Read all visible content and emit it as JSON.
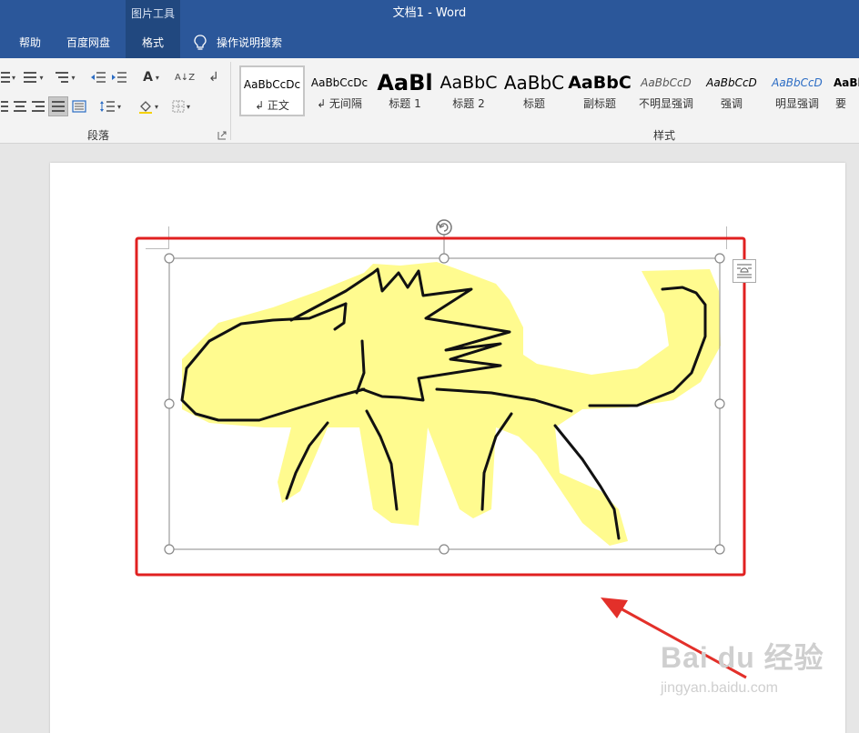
{
  "titlebar": {
    "context_group": "图片工具",
    "title": "文档1  -  Word"
  },
  "tabs": [
    {
      "label": "帮助",
      "active": false
    },
    {
      "label": "百度网盘",
      "active": false
    },
    {
      "label": "格式",
      "active": true
    }
  ],
  "tell_me": {
    "label": "操作说明搜索",
    "icon": "lightbulb-icon"
  },
  "ribbon": {
    "paragraph_group": {
      "label": "段落",
      "icons": [
        "bullets-icon",
        "numbering-icon",
        "multilevel-list-icon",
        "decrease-indent-icon",
        "increase-indent-icon",
        "chinese-layout-icon",
        "sort-icon",
        "show-marks-icon",
        "align-left-icon",
        "center-icon",
        "align-right-icon",
        "justify-icon",
        "distributed-icon",
        "line-spacing-icon",
        "shading-icon",
        "borders-icon",
        "dialog-launcher-icon"
      ],
      "sort_glyph": "A↓Z",
      "pilcrow_glyph": "↲"
    },
    "styles_group": {
      "label": "样式",
      "items": [
        {
          "sample": "AaBbCcDc",
          "name": "↲ 正文",
          "selected": true
        },
        {
          "sample": "AaBbCcDc",
          "name": "↲ 无间隔",
          "selected": false
        },
        {
          "sample": "AaBl",
          "name": "标题 1",
          "selected": false
        },
        {
          "sample": "AaBbC",
          "name": "标题 2",
          "selected": false
        },
        {
          "sample": "AaBbC",
          "name": "标题",
          "selected": false
        },
        {
          "sample": "AaBbC",
          "name": "副标题",
          "selected": false
        },
        {
          "sample": "AaBbCcD",
          "name": "不明显强调",
          "selected": false
        },
        {
          "sample": "AaBbCcD",
          "name": "强调",
          "selected": false
        },
        {
          "sample": "AaBbCcD",
          "name": "明显强调",
          "selected": false
        },
        {
          "sample": "AaBb",
          "name": "要",
          "selected": false
        }
      ]
    }
  },
  "document": {
    "image_alt": "hand-drawn yellow dinosaur sketch",
    "colors": {
      "fill": "#fffb8f",
      "stroke": "#111111",
      "highlight_box": "#e02020",
      "arrow": "#e3302a"
    },
    "handle_icons": [
      "rotate-handle-icon",
      "resize-handle-icon",
      "layout-options-icon"
    ]
  },
  "watermark": {
    "main": "Bai du 经验",
    "sub": "jingyan.baidu.com"
  }
}
